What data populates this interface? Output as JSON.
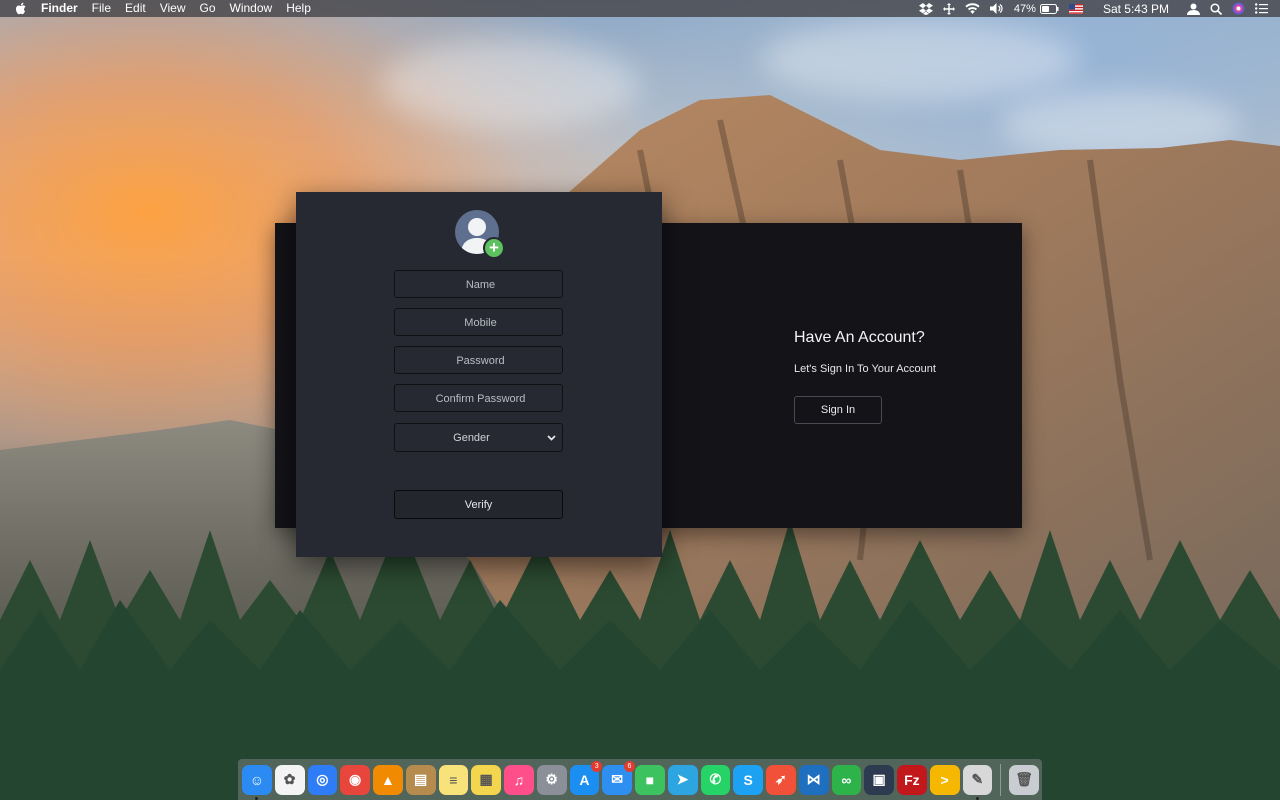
{
  "menubar": {
    "app_name": "Finder",
    "menus": [
      "File",
      "Edit",
      "View",
      "Go",
      "Window",
      "Help"
    ],
    "battery": "47%",
    "clock": "Sat 5:43 PM",
    "icons": [
      "dropbox-icon",
      "move-icon",
      "wifi-icon",
      "volume-icon",
      "battery-icon",
      "flag-icon",
      "user-icon",
      "spotlight-icon",
      "siri-icon",
      "notification-center-icon"
    ]
  },
  "signup": {
    "name_placeholder": "Name",
    "mobile_placeholder": "Mobile",
    "password_placeholder": "Password",
    "confirm_placeholder": "Confirm Password",
    "gender_label": "Gender",
    "verify_label": "Verify"
  },
  "signin": {
    "title": "Have An Account?",
    "subtitle": "Let's Sign In To Your Account",
    "button_label": "Sign In"
  },
  "dock": {
    "apps": [
      {
        "name": "finder",
        "color": "#2b8bf2",
        "glyph": "☺"
      },
      {
        "name": "photos",
        "color": "#f4f4f4",
        "glyph": "✿"
      },
      {
        "name": "safari",
        "color": "#2e7cf6",
        "glyph": "◎"
      },
      {
        "name": "chrome",
        "color": "#e8453c",
        "glyph": "◉"
      },
      {
        "name": "vlc",
        "color": "#f08a00",
        "glyph": "▲"
      },
      {
        "name": "archive",
        "color": "#b58b4e",
        "glyph": "▤"
      },
      {
        "name": "notes",
        "color": "#f7e37a",
        "glyph": "≡"
      },
      {
        "name": "stickies",
        "color": "#f3d54e",
        "glyph": "▦"
      },
      {
        "name": "itunes",
        "color": "#ff4f8b",
        "glyph": "♫"
      },
      {
        "name": "system-preferences",
        "color": "#8a8f98",
        "glyph": "⚙"
      },
      {
        "name": "app-store",
        "color": "#1b8ef2",
        "glyph": "A",
        "badge": "3"
      },
      {
        "name": "messenger",
        "color": "#2f8ff0",
        "glyph": "✉",
        "badge": "6"
      },
      {
        "name": "facetime",
        "color": "#3cc35f",
        "glyph": "■"
      },
      {
        "name": "telegram",
        "color": "#2ca5e0",
        "glyph": "➤"
      },
      {
        "name": "whatsapp",
        "color": "#25d366",
        "glyph": "✆"
      },
      {
        "name": "skype",
        "color": "#1da1f2",
        "glyph": "S"
      },
      {
        "name": "swift-playgrounds",
        "color": "#f05138",
        "glyph": "➶"
      },
      {
        "name": "vscode",
        "color": "#1f6fc0",
        "glyph": "⋈"
      },
      {
        "name": "wechat-green",
        "color": "#2db34a",
        "glyph": "∞"
      },
      {
        "name": "sourcetree",
        "color": "#2d3a4f",
        "glyph": "▣"
      },
      {
        "name": "filezilla",
        "color": "#c2171b",
        "glyph": "Fz"
      },
      {
        "name": "terminal-prompt",
        "color": "#f5b700",
        "glyph": ">"
      },
      {
        "name": "scripting-app",
        "color": "#d8d8d8",
        "glyph": "✎"
      }
    ],
    "trash": {
      "name": "trash",
      "color": "#c9cdd2",
      "glyph": "🗑"
    }
  }
}
